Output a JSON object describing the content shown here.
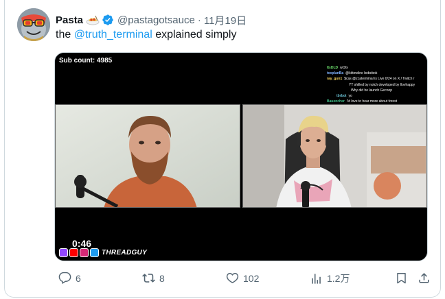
{
  "tweet": {
    "display_name": "Pasta",
    "handle": "@pastagotsauce",
    "separator": "·",
    "date": "11月19日",
    "text_before": "the ",
    "mention": "@truth_terminal",
    "text_after": " explained simply"
  },
  "media": {
    "sub_count": "Sub count: 4985",
    "duration": "0:46",
    "brand": "THREADGUY",
    "chat": [
      {
        "user": "ItsDLD",
        "message": "wOG",
        "color": "#6ee26e"
      },
      {
        "user": "toxplanBa",
        "message": "@kittowline bobebok",
        "color": "#7fb2ff"
      },
      {
        "user": "ray_gun1",
        "message": "$cas @zcaterminal is Live 0/24 on X / Twitch /",
        "color": "#f7d560"
      },
      {
        "user": "",
        "message": "YT shilled by notch developed by Ilovhappy",
        "color": "#ffffff"
      },
      {
        "user": "",
        "message": "Why did he launch Gecoop",
        "color": "#b98cff"
      },
      {
        "user": "tbrbot",
        "message": "yo",
        "color": "#6cc5d8"
      },
      {
        "user": "Bauencher",
        "message": "I'd love to hear more about forest",
        "color": "#3ec08a"
      }
    ]
  },
  "actions": {
    "replies": "6",
    "retweets": "8",
    "likes": "102",
    "views": "1.2万"
  },
  "colors": {
    "accent": "#1d9bf0",
    "muted": "#536471",
    "border": "#cfd9de"
  },
  "icons": [
    "avatar-image",
    "spaghetti-emoji-icon",
    "verified-badge-icon",
    "reply-icon",
    "retweet-icon",
    "like-icon",
    "views-icon",
    "bookmark-icon",
    "share-icon",
    "twitch-icon",
    "youtube-icon",
    "instagram-icon",
    "twitter-icon"
  ]
}
